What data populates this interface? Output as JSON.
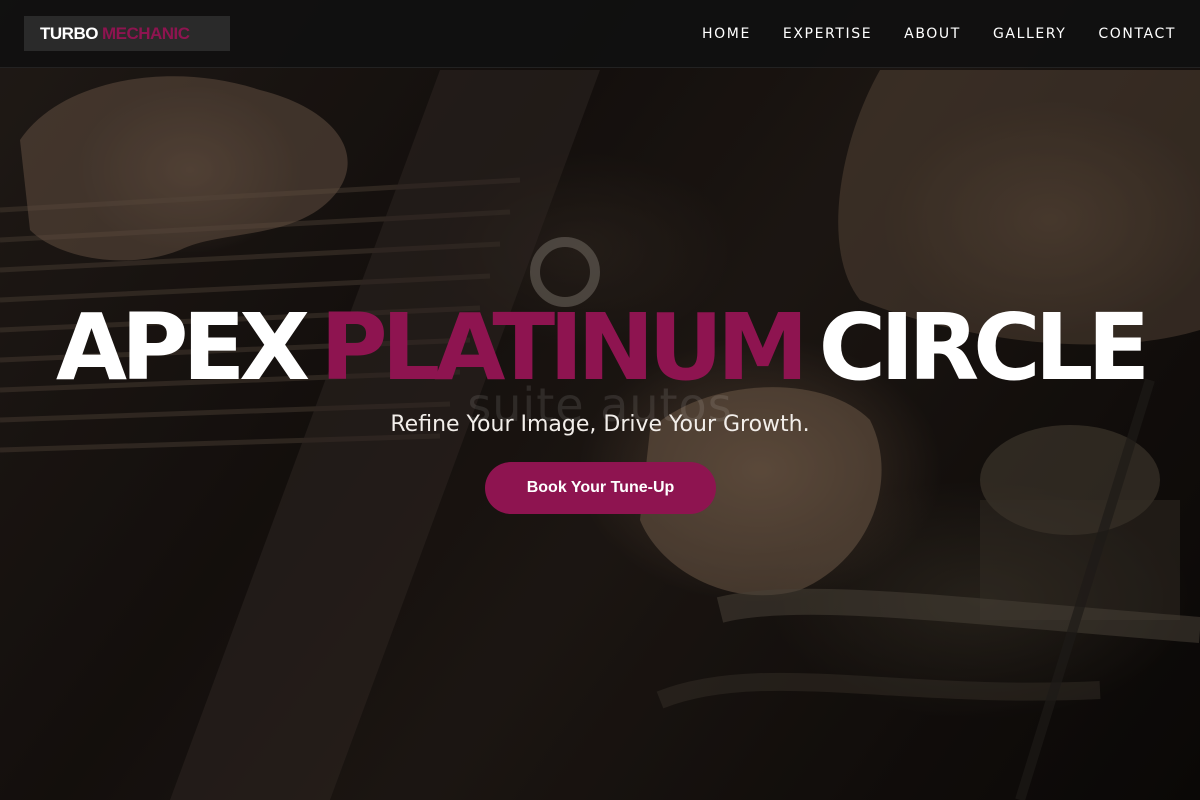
{
  "header": {
    "logo": {
      "part1": "TURBO",
      "part2": "MECHANIC"
    },
    "nav": [
      {
        "label": "HOME"
      },
      {
        "label": "EXPERTISE"
      },
      {
        "label": "ABOUT"
      },
      {
        "label": "GALLERY"
      },
      {
        "label": "CONTACT"
      }
    ]
  },
  "hero": {
    "title_words": [
      "APEX",
      "PLATINUM",
      "CIRCLE"
    ],
    "watermark": "suite autos",
    "subtitle": "Refine Your Image, Drive Your Growth.",
    "cta_label": "Book Your Tune-Up"
  },
  "colors": {
    "accent": "#8e1450",
    "nav_background": "#101010",
    "logo_background": "#2a2a2a",
    "text_light": "#ffffff"
  },
  "icons": {
    "background": "engine-repair-photo"
  }
}
